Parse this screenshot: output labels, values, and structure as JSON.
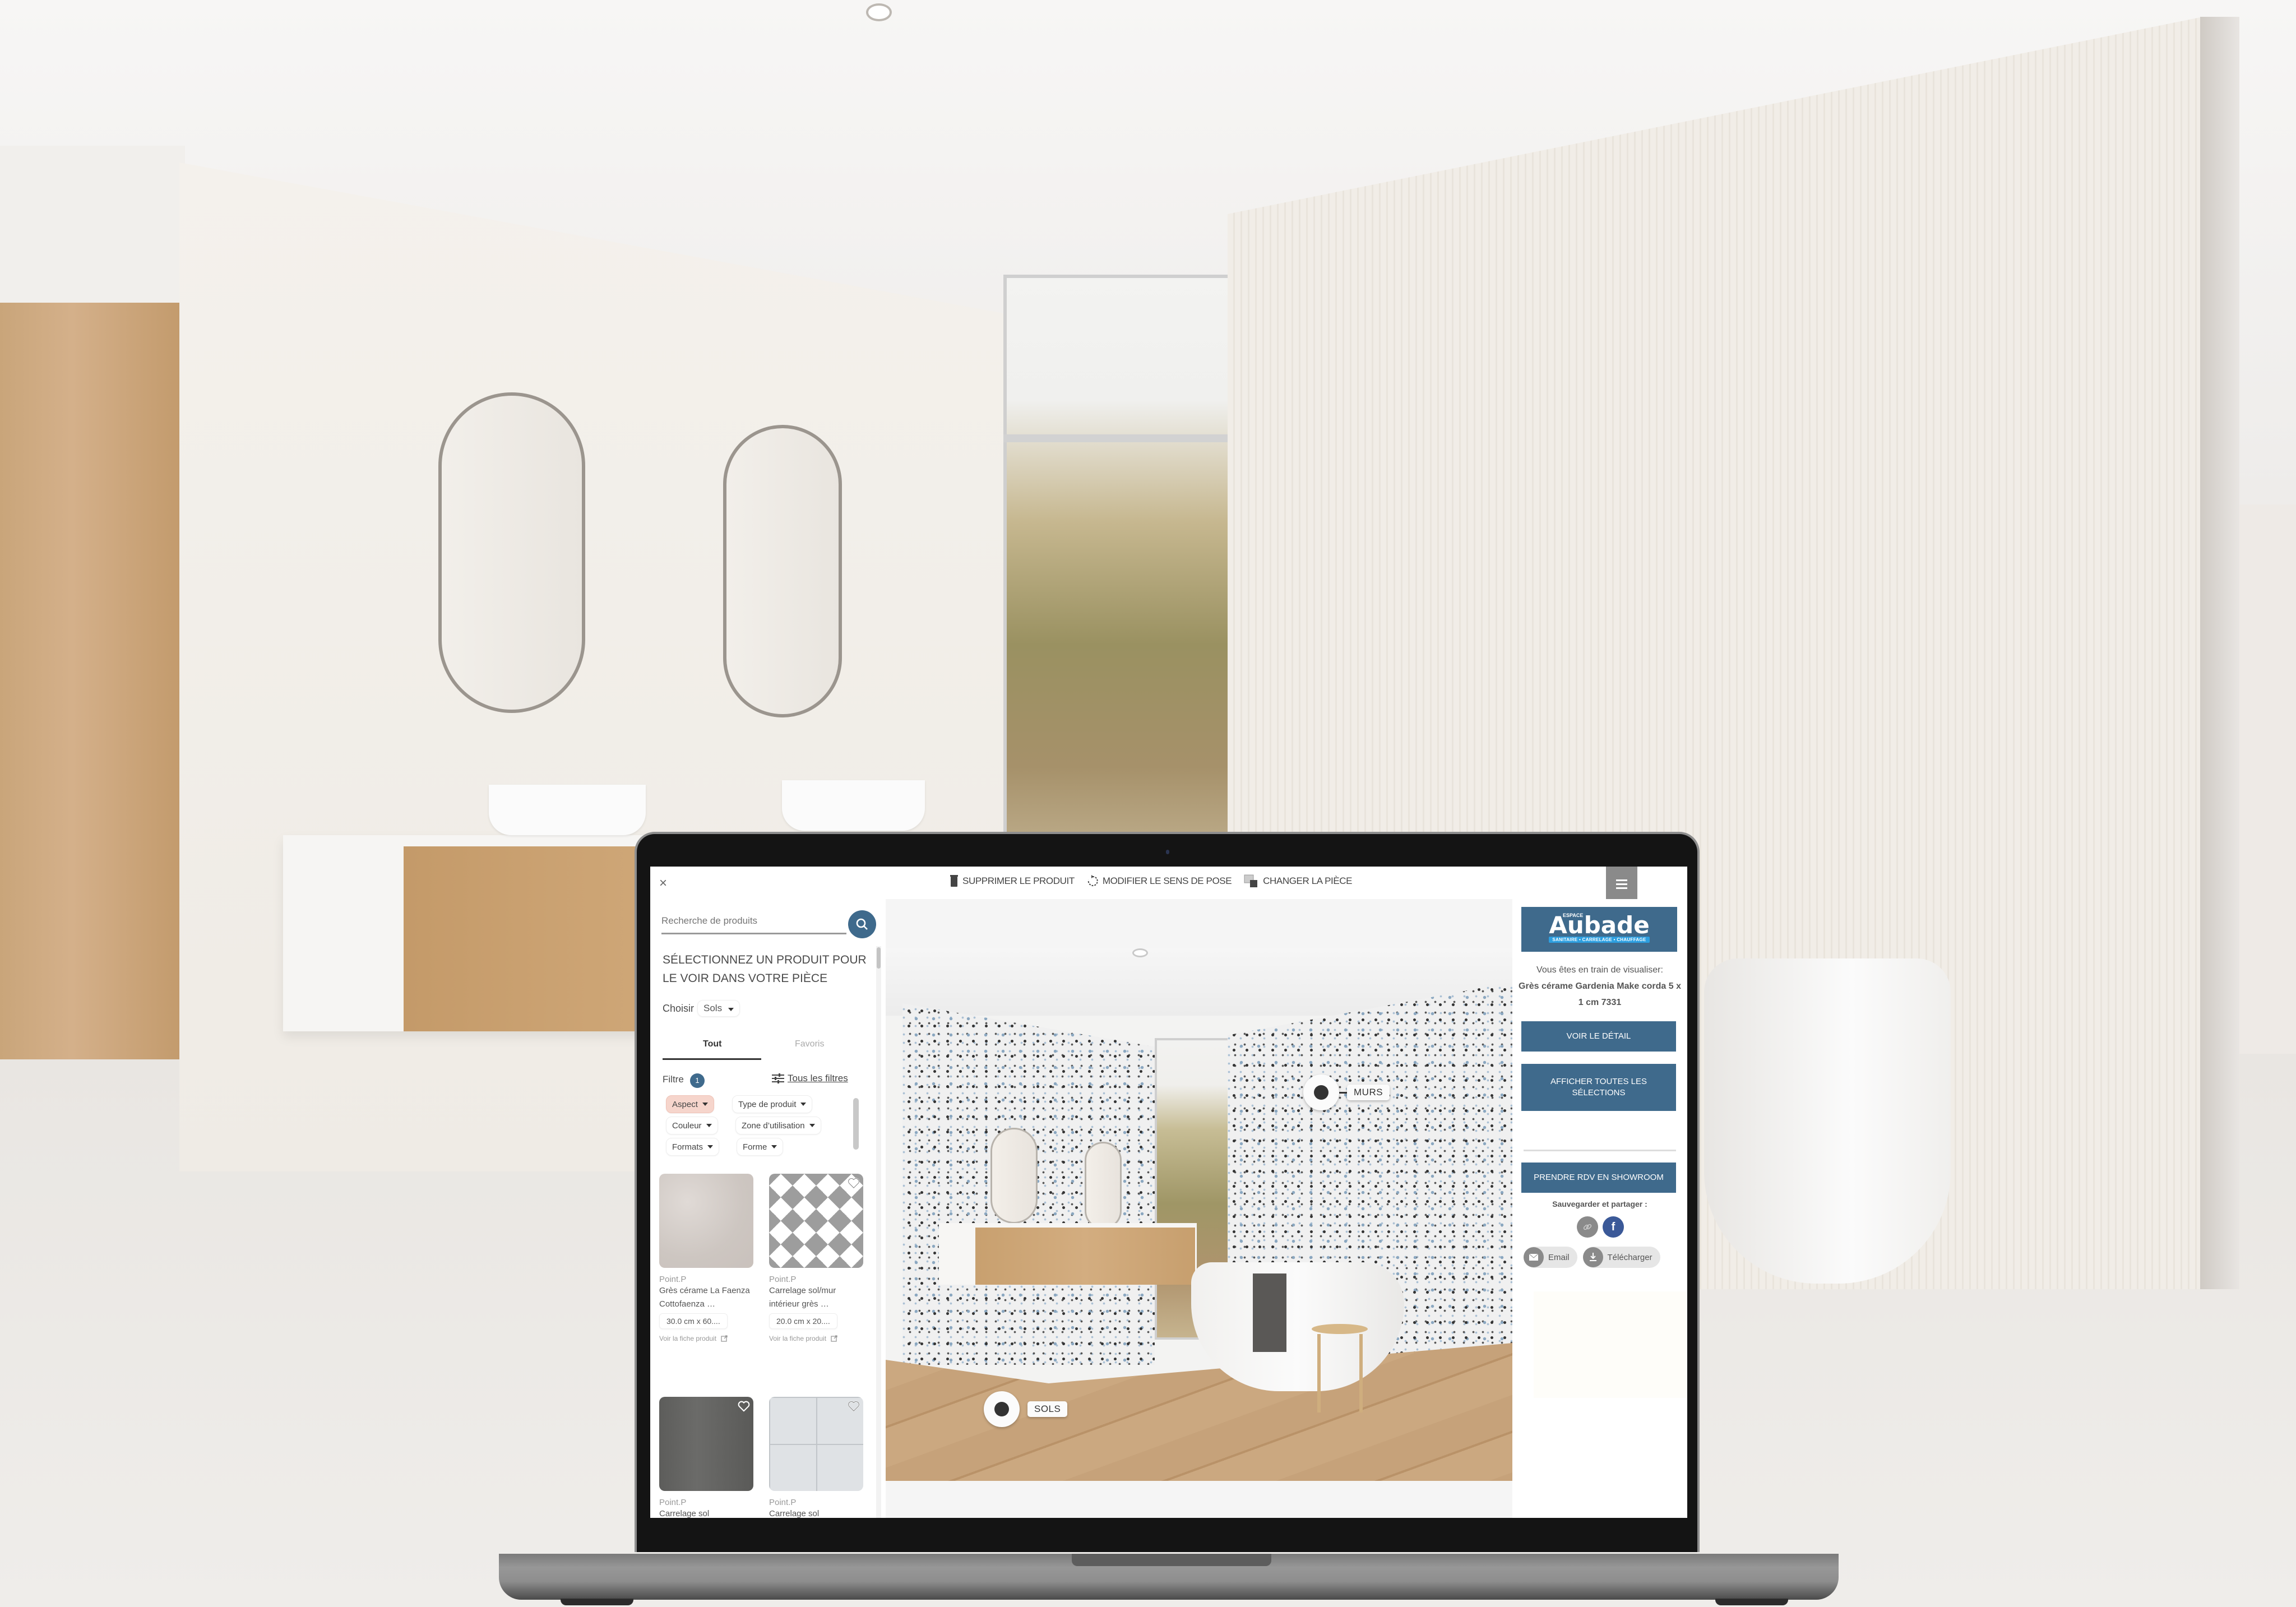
{
  "toolbar": {
    "close_label": "×",
    "delete_product": "SUPPRIMER LE PRODUIT",
    "change_direction": "MODIFIER LE SENS DE POSE",
    "change_room": "CHANGER LA PIÈCE"
  },
  "search": {
    "placeholder": "Recherche de produits"
  },
  "left_panel": {
    "select_title": "SÉLECTIONNEZ UN PRODUIT POUR LE VOIR DANS VOTRE PIÈCE",
    "choose_label": "Choisir",
    "choose_value": "Sols",
    "tabs": [
      {
        "label": "Tout",
        "active": true
      },
      {
        "label": "Favoris",
        "active": false
      }
    ],
    "filter_label": "Filtre",
    "filter_count": "1",
    "all_filters": "Tous les filtres",
    "chips": [
      {
        "label": "Aspect",
        "active": true
      },
      {
        "label": "Type de produit",
        "active": false
      },
      {
        "label": "Couleur",
        "active": false
      },
      {
        "label": "Zone d’utilisation",
        "active": false
      },
      {
        "label": "Formats",
        "active": false
      },
      {
        "label": "Forme",
        "active": false
      }
    ],
    "products": [
      {
        "brand": "Point.P",
        "name": "Grès cérame La Faenza Cottofaenza …",
        "size": "30.0 cm x 60....",
        "link": "Voir la fiche produit",
        "texture": "leaf"
      },
      {
        "brand": "Point.P",
        "name": "Carrelage sol/mur intérieur grès …",
        "size": "20.0 cm x 20....",
        "link": "Voir la fiche produit",
        "texture": "diamond"
      },
      {
        "brand": "Point.P",
        "name": "Carrelage sol",
        "texture": "dark"
      },
      {
        "brand": "Point.P",
        "name": "Carrelage sol",
        "texture": "grid"
      }
    ]
  },
  "scene": {
    "hotspots": [
      {
        "label": "MURS"
      },
      {
        "label": "SOLS"
      }
    ]
  },
  "right_panel": {
    "logo_small": "ESPACE",
    "logo_main": "Aubade",
    "logo_tagline": "SANITAIRE • CARRELAGE • CHAUFFAGE",
    "viewing_label": "Vous êtes en train de visualiser:",
    "viewing_product": "Grès cérame Gardenia Make corda 5 x 1 cm 7331",
    "btn_detail": "VOIR LE DÉTAIL",
    "btn_all_selections": "AFFICHER TOUTES LES SÉLECTIONS",
    "btn_showroom": "PRENDRE RDV EN SHOWROOM",
    "share_label": "Sauvegarder et partager :",
    "email_label": "Email",
    "download_label": "Télécharger"
  },
  "colors": {
    "brand_blue": "#3f6a8c",
    "chip_active": "#f6d5cc",
    "facebook": "#3b5998",
    "logo_band": "#2d9fe0"
  }
}
